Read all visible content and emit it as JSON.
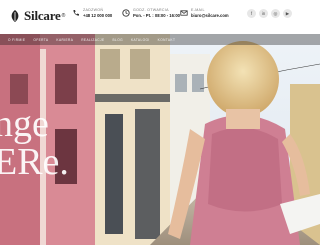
{
  "brand": {
    "name": "Silcare",
    "mark": "®"
  },
  "contact": [
    {
      "label": "ZADZWOŃ",
      "value": "+48 12 000 000",
      "icon": "phone-icon"
    },
    {
      "label": "GODZ. OTWARCIA",
      "value": "Pon. - Pt. : 08:00 - 16:00",
      "icon": "clock-icon"
    },
    {
      "label": "E-MAIL",
      "value": "biuro@silcare.com",
      "icon": "mail-icon"
    }
  ],
  "socials": [
    {
      "glyph": "f",
      "icon": "facebook-icon"
    },
    {
      "glyph": "in",
      "icon": "linkedin-icon"
    },
    {
      "glyph": "◎",
      "icon": "instagram-icon"
    },
    {
      "glyph": "▶",
      "icon": "youtube-icon"
    }
  ],
  "nav": [
    "O FIRMIE",
    "OFERTA",
    "KARIERA",
    "REALIZACJE",
    "BLOG",
    "KATALOGI",
    "KONTAKT"
  ],
  "hero": {
    "line1": "nge",
    "line2": "ERe."
  },
  "colors": {
    "accent": "#e8a7b8",
    "dark": "#222222"
  }
}
